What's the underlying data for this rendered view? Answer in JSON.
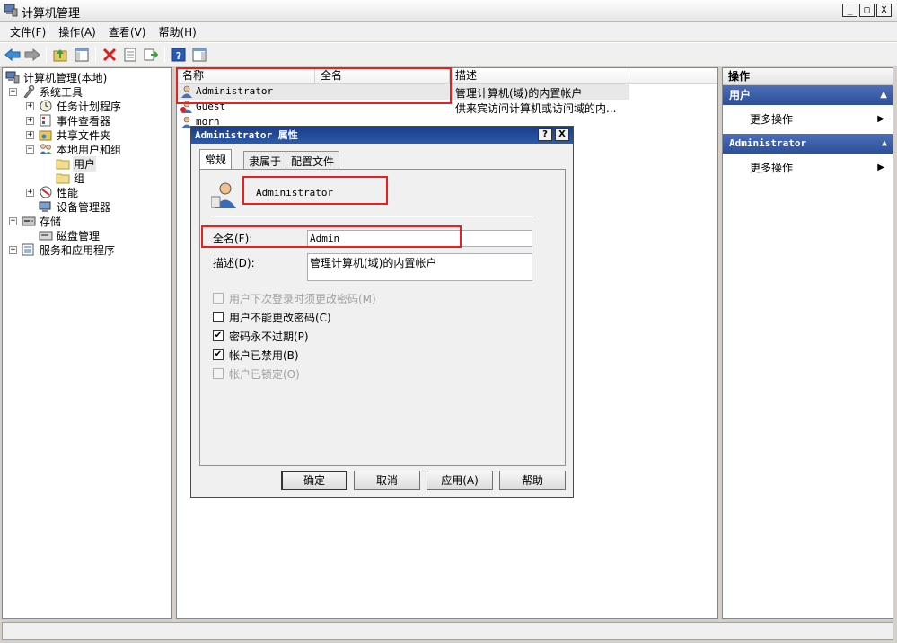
{
  "window": {
    "title": "计算机管理",
    "controls": {
      "minimize": "_",
      "maximize": "□",
      "close": "X"
    }
  },
  "menubar": {
    "items": [
      {
        "label": "文件(F)"
      },
      {
        "label": "操作(A)"
      },
      {
        "label": "查看(V)"
      },
      {
        "label": "帮助(H)"
      }
    ]
  },
  "toolbar": {
    "icons": [
      "back-arrow-icon",
      "forward-arrow-icon",
      "up-folder-icon",
      "show-hide-tree-icon",
      "delete-icon",
      "properties-icon",
      "export-list-icon",
      "help-icon",
      "show-hide-action-icon"
    ]
  },
  "tree": {
    "items": [
      {
        "label": "计算机管理(本地)",
        "icon": "computer-management-icon",
        "expander": ""
      },
      {
        "label": "系统工具",
        "icon": "tools-icon",
        "expander": "−"
      },
      {
        "label": "任务计划程序",
        "icon": "clock-icon",
        "expander": "+"
      },
      {
        "label": "事件查看器",
        "icon": "event-viewer-icon",
        "expander": "+"
      },
      {
        "label": "共享文件夹",
        "icon": "shared-folder-icon",
        "expander": "+"
      },
      {
        "label": "本地用户和组",
        "icon": "users-group-icon",
        "expander": "−"
      },
      {
        "label": "用户",
        "icon": "folder-icon",
        "expander": ""
      },
      {
        "label": "组",
        "icon": "folder-icon",
        "expander": ""
      },
      {
        "label": "性能",
        "icon": "performance-icon",
        "expander": "+"
      },
      {
        "label": "设备管理器",
        "icon": "device-manager-icon",
        "expander": ""
      },
      {
        "label": "存储",
        "icon": "storage-icon",
        "expander": "−"
      },
      {
        "label": "磁盘管理",
        "icon": "disk-icon",
        "expander": ""
      },
      {
        "label": "服务和应用程序",
        "icon": "services-icon",
        "expander": "+"
      }
    ]
  },
  "list": {
    "columns": [
      "名称",
      "全名",
      "描述"
    ],
    "rows": [
      {
        "name": "Administrator",
        "fullname": "",
        "description": "管理计算机(域)的内置帐户"
      },
      {
        "name": "Guest",
        "fullname": "",
        "description": "供来宾访问计算机或访问域的内..."
      },
      {
        "name": "morn",
        "fullname": "",
        "description": ""
      }
    ]
  },
  "actions": {
    "header": "操作",
    "sections": [
      {
        "title": "用户",
        "items": [
          "更多操作"
        ]
      },
      {
        "title": "Administrator",
        "items": [
          "更多操作"
        ]
      }
    ]
  },
  "dialog": {
    "title": "Administrator 属性",
    "help_btn": "?",
    "close_btn": "X",
    "tabs": [
      "常规",
      "隶属于",
      "配置文件"
    ],
    "username": "Administrator",
    "fullname_label": "全名(F):",
    "fullname_value": "Admin",
    "desc_label": "描述(D):",
    "desc_value": "管理计算机(域)的内置帐户",
    "checkboxes": [
      {
        "label": "用户下次登录时须更改密码(M)",
        "checked": false,
        "disabled": true
      },
      {
        "label": "用户不能更改密码(C)",
        "checked": false,
        "disabled": false
      },
      {
        "label": "密码永不过期(P)",
        "checked": true,
        "disabled": false
      },
      {
        "label": "帐户已禁用(B)",
        "checked": true,
        "disabled": false
      },
      {
        "label": "帐户已锁定(O)",
        "checked": false,
        "disabled": true
      }
    ],
    "buttons": {
      "ok": "确定",
      "cancel": "取消",
      "apply": "应用(A)",
      "help": "帮助"
    }
  },
  "colors": {
    "highlight_box": "#e82020",
    "action_section": "#2d4f99"
  }
}
